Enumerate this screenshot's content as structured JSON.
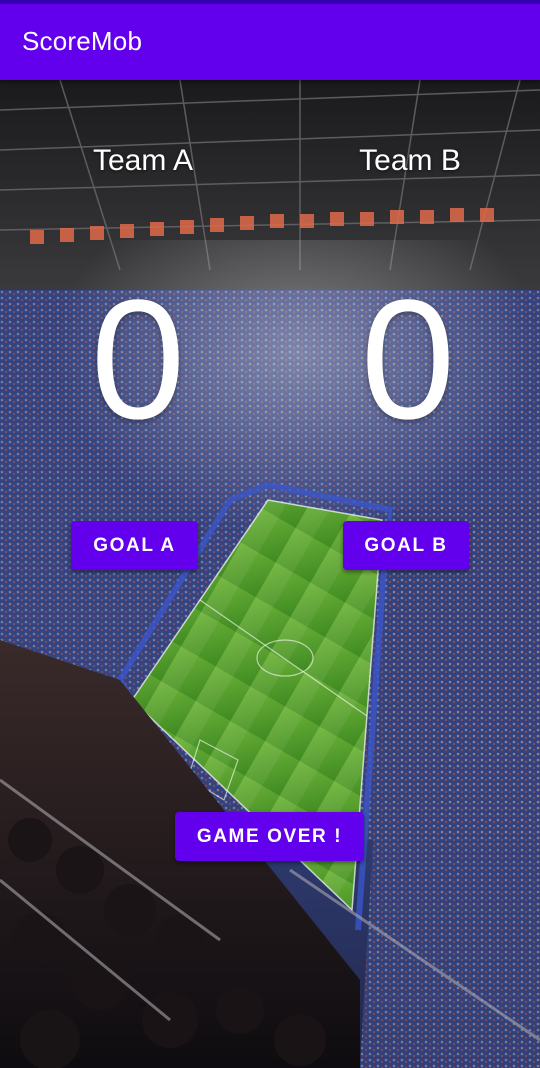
{
  "app": {
    "title": "ScoreMob"
  },
  "teams": {
    "a": {
      "name": "Team A",
      "score": "0"
    },
    "b": {
      "name": "Team B",
      "score": "0"
    }
  },
  "buttons": {
    "goal_a": "GOAL A",
    "goal_b": "GOAL B",
    "game_over": "GAME OVER !"
  },
  "colors": {
    "primary": "#6200ee",
    "primary_dark": "#3700b3",
    "text_on_primary": "#ffffff"
  }
}
